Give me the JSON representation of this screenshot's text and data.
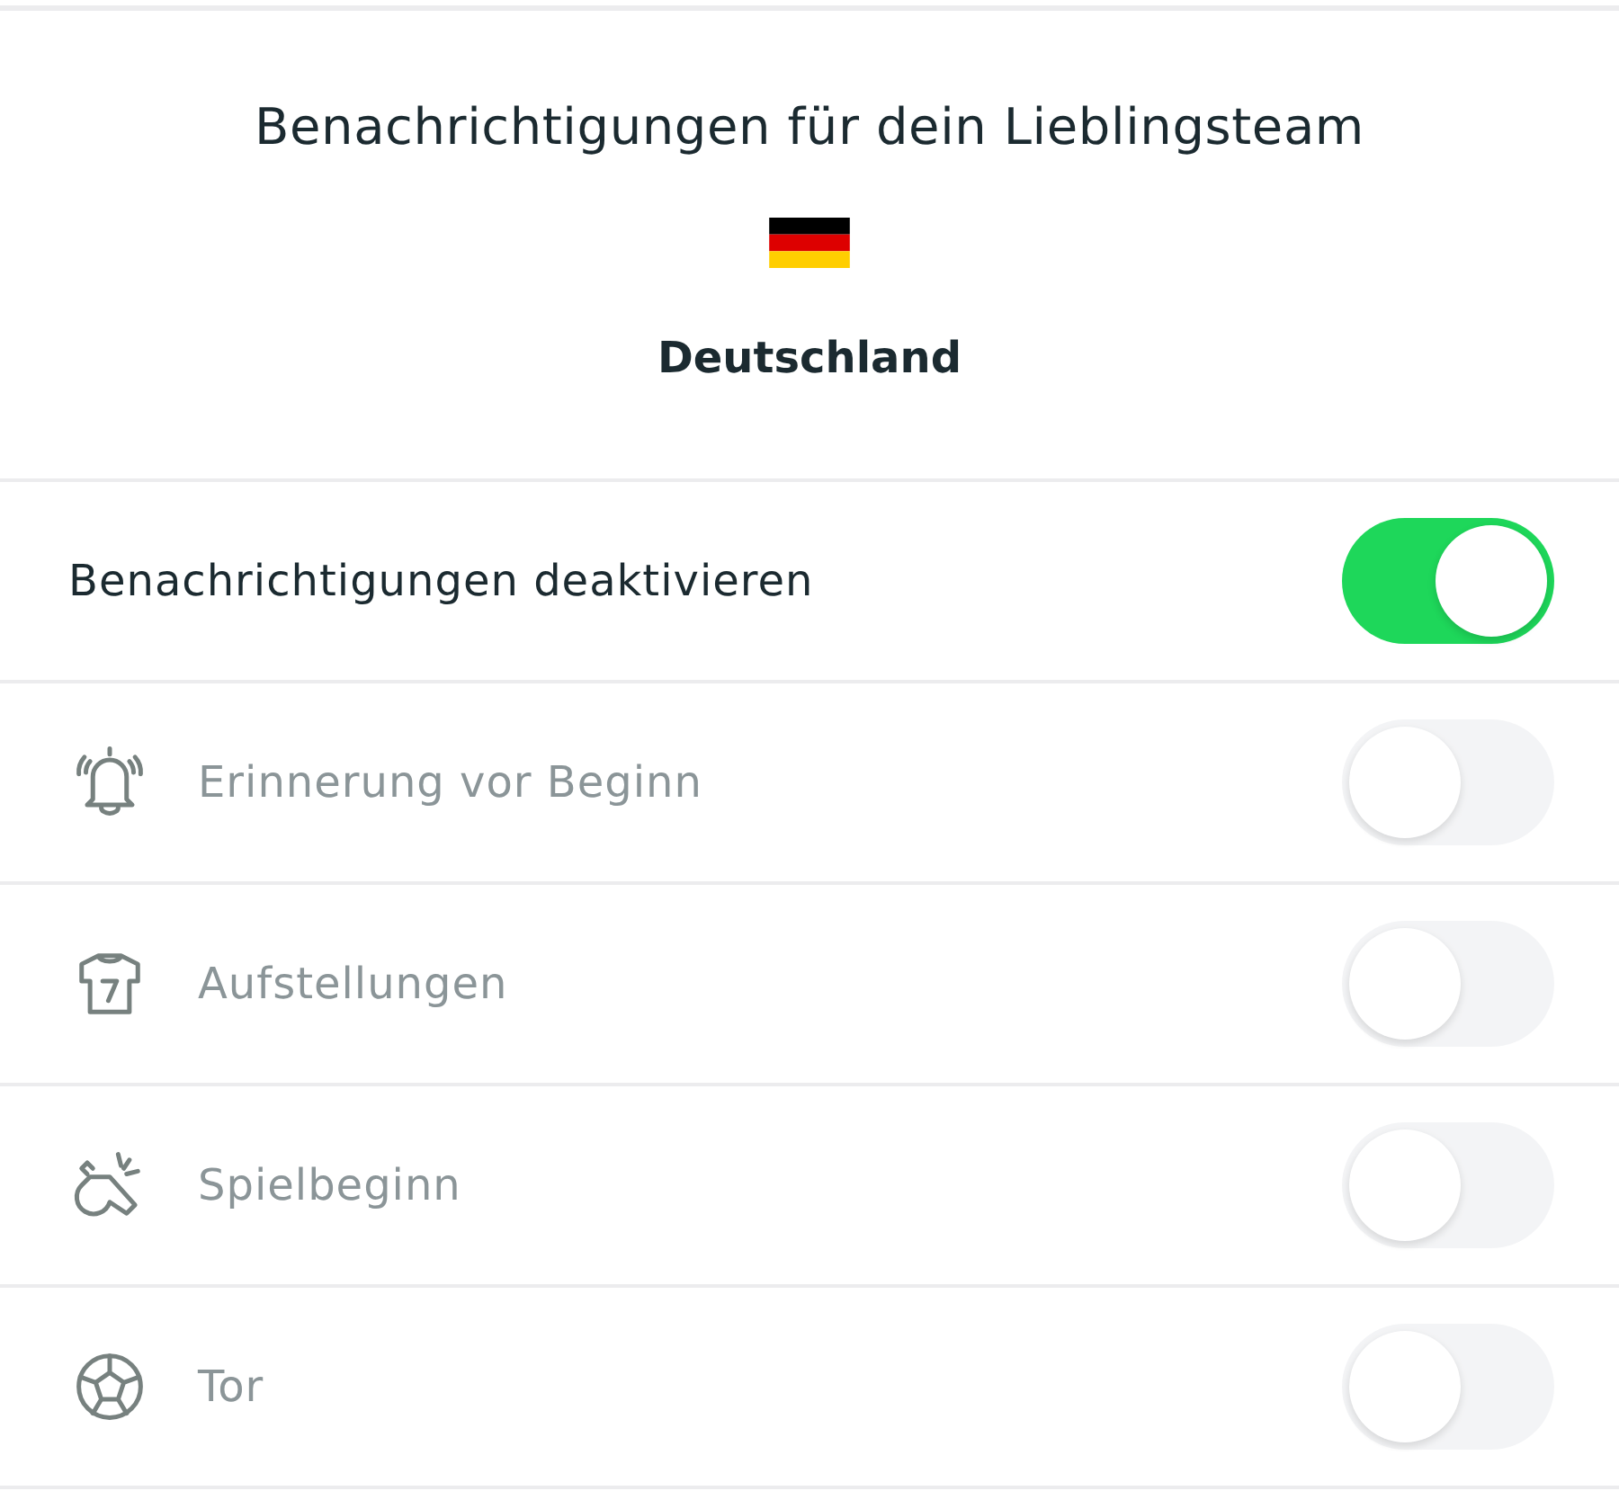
{
  "header": {
    "title": "Benachrichtigungen für dein Lieblingsteam",
    "team": "Deutschland"
  },
  "master": {
    "label": "Benachrichtigungen deaktivieren",
    "on": true
  },
  "settings": [
    {
      "kind": "reminder",
      "label": "Erinnerung vor Beginn",
      "on": false,
      "disabled": true
    },
    {
      "kind": "lineups",
      "label": "Aufstellungen",
      "on": false,
      "disabled": true
    },
    {
      "kind": "kickoff",
      "label": "Spielbeginn",
      "on": false,
      "disabled": true
    },
    {
      "kind": "goal",
      "label": "Tor",
      "on": false,
      "disabled": true
    }
  ]
}
